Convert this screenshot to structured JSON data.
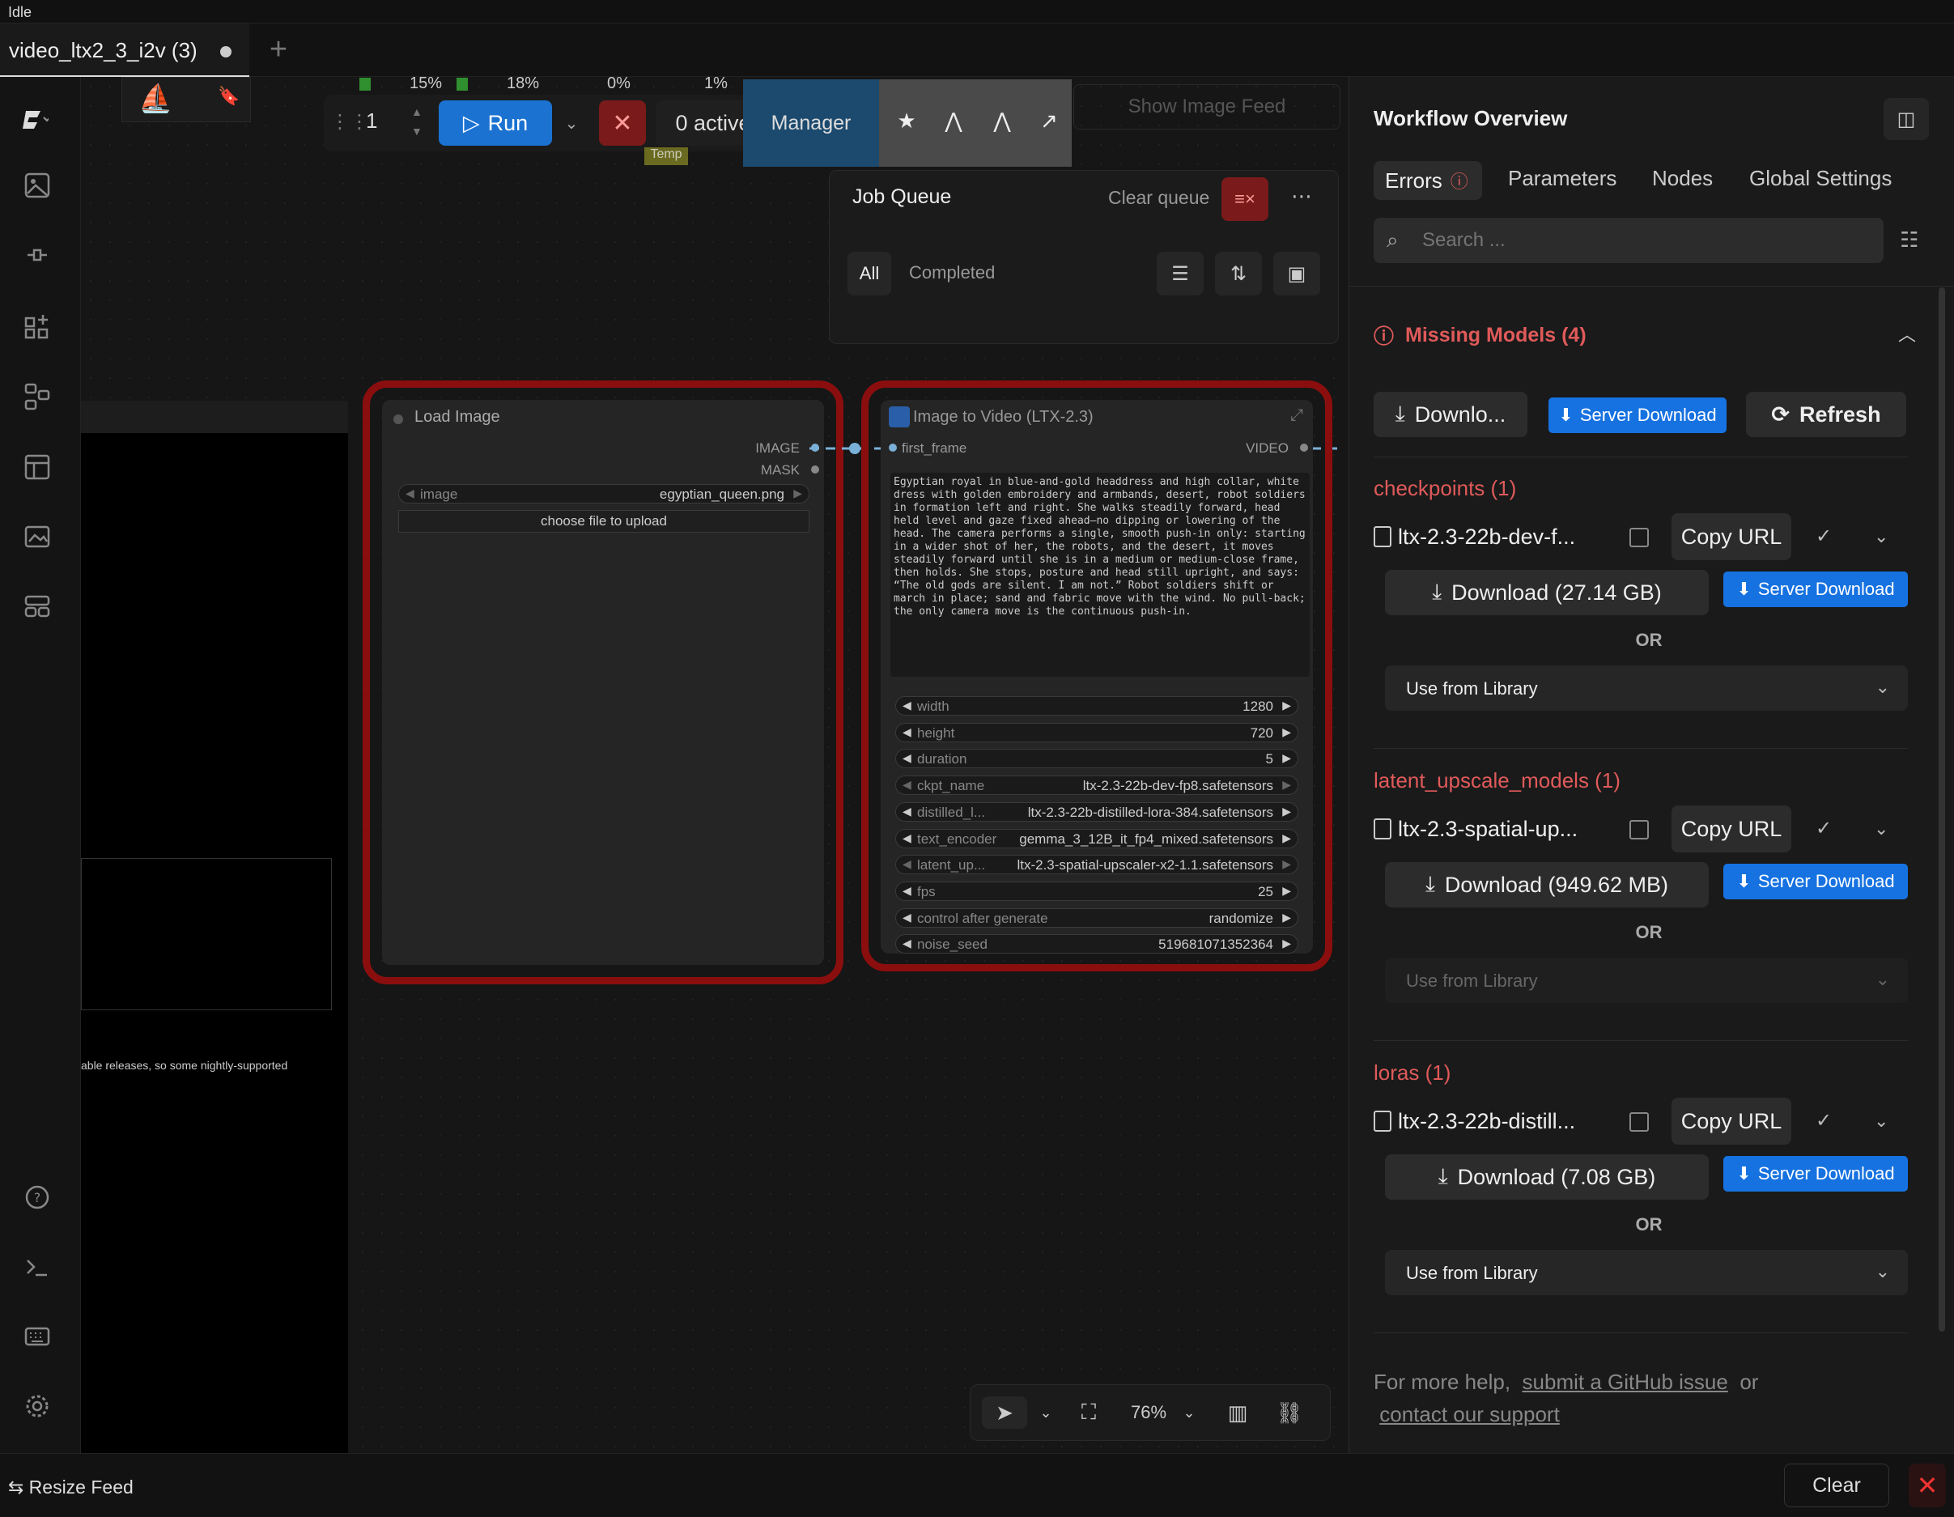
{
  "status": {
    "idle": "Idle"
  },
  "tab": {
    "title": "video_ltx2_3_i2v (3)",
    "add": "+"
  },
  "gauges": [
    "15%",
    "18%",
    "0%",
    "1%"
  ],
  "run": {
    "batch": "1",
    "label": "Run",
    "active": "0 active",
    "temp": "Temp"
  },
  "manager": {
    "label": "Manager"
  },
  "show_feed": "Show Image Feed",
  "job_queue": {
    "title": "Job Queue",
    "clear": "Clear queue",
    "tab_all": "All",
    "tab_completed": "Completed"
  },
  "left_panel_text": "able releases, so some nightly-supported",
  "node_load_image": {
    "title": "Load Image",
    "out_image": "IMAGE",
    "out_mask": "MASK",
    "image_label": "image",
    "image_value": "egyptian_queen.png",
    "upload": "choose file to upload"
  },
  "node_i2v": {
    "title": "Image to Video (LTX-2.3)",
    "in_first_frame": "first_frame",
    "out_video": "VIDEO",
    "prompt": "Egyptian royal in blue-and-gold headdress and high collar, white dress with golden embroidery and armbands, desert, robot soldiers in formation left and right. She walks steadily forward, head held level and gaze fixed ahead—no dipping or lowering of the head. The camera performs a single, smooth push-in only: starting in a wider shot of her, the robots, and the desert, it moves steadily forward until she is in a medium or medium-close frame, then holds. She stops, posture and head still upright, and says: “The old gods are silent. I am not.” Robot soldiers shift or march in place; sand and fabric move with the wind. No pull-back; the only camera move is the continuous push-in.",
    "widgets": [
      {
        "label": "width",
        "value": "1280",
        "dim": false
      },
      {
        "label": "height",
        "value": "720",
        "dim": false
      },
      {
        "label": "duration",
        "value": "5",
        "dim": false
      },
      {
        "label": "ckpt_name",
        "value": "ltx-2.3-22b-dev-fp8.safetensors",
        "dim": true
      },
      {
        "label": "distilled_l...",
        "value": "ltx-2.3-22b-distilled-lora-384.safetensors",
        "dim": false
      },
      {
        "label": "text_encoder",
        "value": "gemma_3_12B_it_fp4_mixed.safetensors",
        "dim": false
      },
      {
        "label": "latent_up...",
        "value": "ltx-2.3-spatial-upscaler-x2-1.1.safetensors",
        "dim": true
      },
      {
        "label": "fps",
        "value": "25",
        "dim": false
      },
      {
        "label": "control after generate",
        "value": "randomize",
        "dim": false
      },
      {
        "label": "noise_seed",
        "value": "519681071352364",
        "dim": false
      }
    ]
  },
  "panel": {
    "title": "Workflow Overview",
    "tabs": [
      "Errors",
      "Parameters",
      "Nodes",
      "Global Settings"
    ],
    "search_placeholder": "Search ...",
    "missing_models": "Missing Models (4)",
    "download_all": "Downlo...",
    "server_download": "Server Download",
    "refresh": "Refresh",
    "copy_url": "Copy URL",
    "or": "OR",
    "use_from_library": "Use from Library",
    "categories": [
      {
        "name": "checkpoints (1)",
        "file": "ltx-2.3-22b-dev-f...",
        "download": "Download (27.14 GB)",
        "library_dim": false
      },
      {
        "name": "latent_upscale_models (1)",
        "file": "ltx-2.3-spatial-up...",
        "download": "Download (949.62 MB)",
        "library_dim": true
      },
      {
        "name": "loras (1)",
        "file": "ltx-2.3-22b-distill...",
        "download": "Download (7.08 GB)",
        "library_dim": false
      }
    ],
    "help_prefix": "For more help,",
    "help_link1": "submit a GitHub issue",
    "help_or": "or",
    "help_link2": "contact our support"
  },
  "bottom": {
    "resize_feed": "Resize Feed",
    "clear": "Clear"
  },
  "canvas_ctrl": {
    "zoom": "76%"
  },
  "colors": {
    "accent_blue": "#1672e0",
    "error_red": "#e05a5a",
    "node_outline": "#8b0e0e",
    "manager_bg": "#1c4a6e"
  }
}
